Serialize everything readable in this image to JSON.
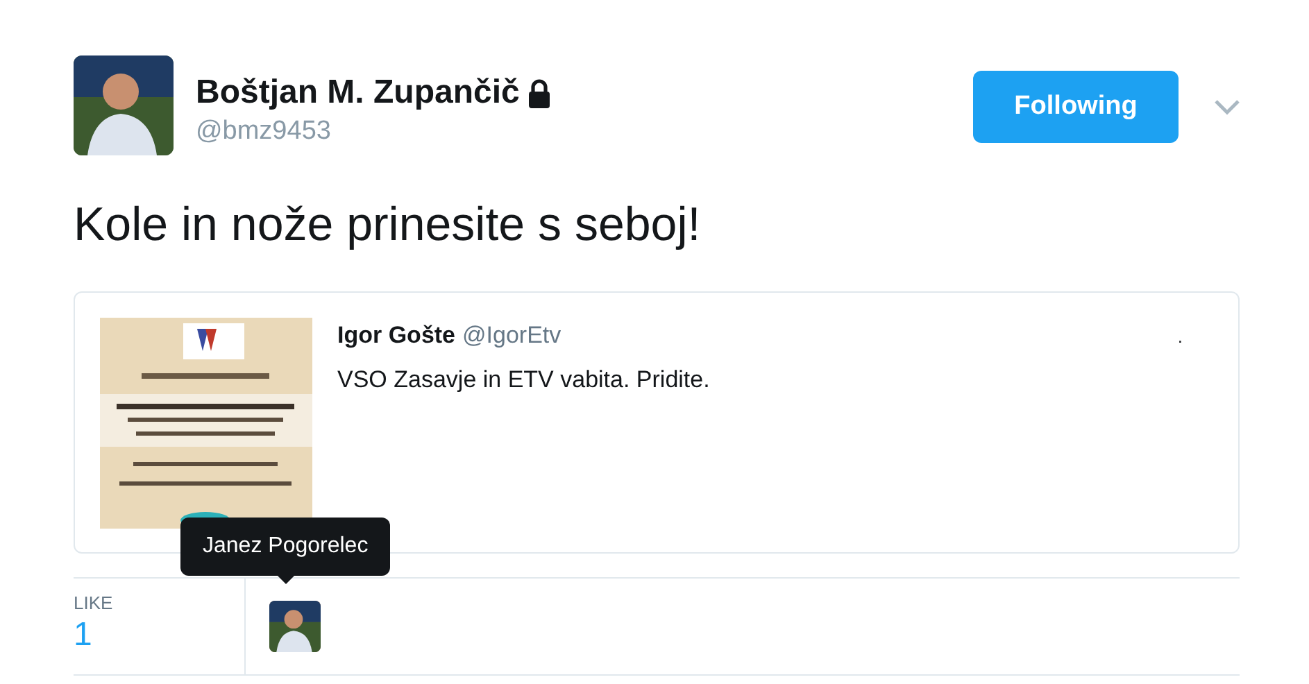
{
  "author": {
    "name": "Boštjan M. Zupančič",
    "protected": true,
    "handle": "@bmz9453"
  },
  "follow_button": {
    "label": "Following",
    "following": true
  },
  "tweet_text": "Kole in nože prinesite s seboj!",
  "quoted_tweet": {
    "name": "Igor Gošte",
    "handle": "@IgorEtv",
    "text": "VSO Zasavje in ETV vabita. Pridite.",
    "marker": "."
  },
  "likes": {
    "label": "LIKE",
    "count": "1"
  },
  "tooltip": {
    "text": "Janez Pogorelec"
  }
}
